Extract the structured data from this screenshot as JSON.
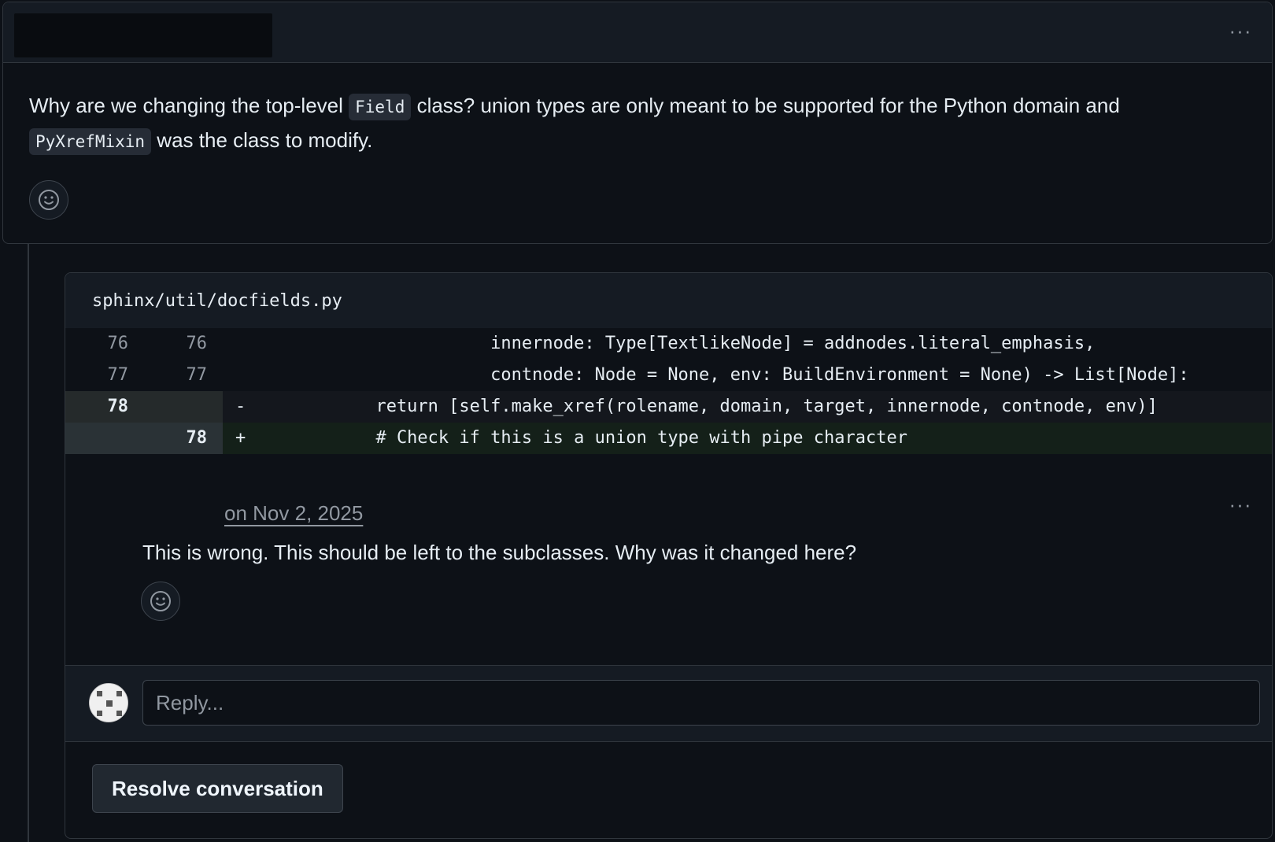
{
  "top_comment": {
    "body_parts": {
      "p1": "Why are we changing the top-level ",
      "code1": "Field",
      "p2": " class? union types are only meant to be supported for the Python domain and ",
      "code2": "PyXrefMixin",
      "p3": " was the class to modify."
    },
    "menu_label": "···"
  },
  "thread": {
    "file_path": "sphinx/util/docfields.py",
    "diff_lines": [
      {
        "old": "76",
        "new": "76",
        "sign": "",
        "code": "                     innernode: Type[TextlikeNode] = addnodes.literal_emphasis,"
      },
      {
        "old": "77",
        "new": "77",
        "sign": "",
        "code": "                     contnode: Node = None, env: BuildEnvironment = None) -> List[Node]:"
      },
      {
        "old": "78",
        "new": "",
        "sign": "-",
        "code": "          return [self.make_xref(rolename, domain, target, innernode, contnode, env)]"
      },
      {
        "old": "",
        "new": "78",
        "sign": "+",
        "code": "          # Check if this is a union type with pipe character"
      }
    ],
    "reply": {
      "date": "on Nov 2, 2025",
      "body": "This is wrong. This should be left to the subclasses. Why was it changed here?",
      "menu_label": "···"
    },
    "reply_input_placeholder": "Reply...",
    "resolve_label": "Resolve conversation"
  },
  "colors": {
    "background": "#0d1117",
    "border": "#30363d",
    "deleted_row": "#14171d",
    "added_row": "#142019"
  }
}
